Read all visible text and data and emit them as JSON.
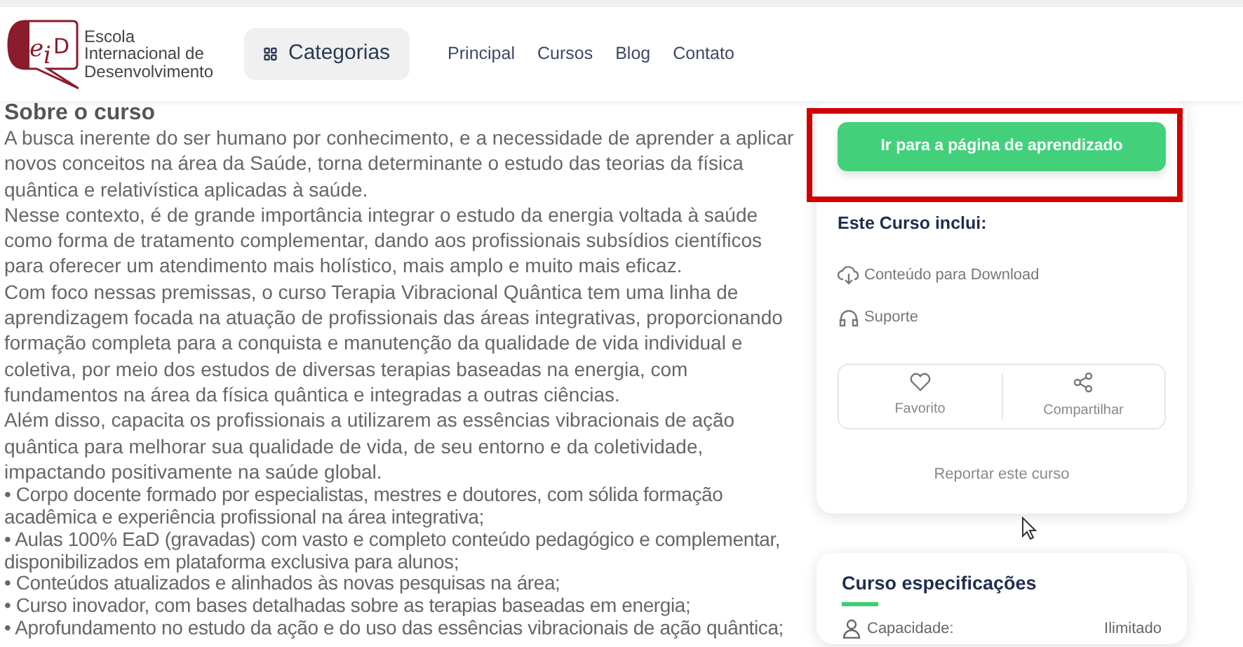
{
  "header": {
    "logo": {
      "mark": "eiD",
      "name_lines": [
        "Escola",
        "Internacional de",
        "Desenvolvimento"
      ]
    },
    "categories_button": "Categorias",
    "nav": [
      {
        "label": "Principal"
      },
      {
        "label": "Cursos"
      },
      {
        "label": "Blog"
      },
      {
        "label": "Contato"
      }
    ]
  },
  "about": {
    "title": "Sobre o curso",
    "paragraphs": [
      {
        "kind": "text",
        "text": "A busca inerente do ser humano por conhecimento, e a necessidade de aprender a aplicar novos conceitos na área da Saúde, torna determinante o estudo das teorias da física quântica e relativística aplicadas à saúde."
      },
      {
        "kind": "text",
        "text": "Nesse contexto, é de grande importância integrar o estudo da energia voltada à saúde como forma de tratamento complementar, dando aos profissionais subsídios científicos para oferecer um atendimento mais holístico, mais amplo e muito mais eficaz."
      },
      {
        "kind": "text",
        "text": "Com foco nessas premissas, o curso Terapia Vibracional Quântica tem uma linha de aprendizagem focada na atuação de profissionais das áreas integrativas, proporcionando formação completa para a conquista e manutenção da qualidade de vida individual e coletiva, por meio dos estudos de diversas terapias baseadas na energia, com fundamentos na área da física quântica e integradas a outras ciências."
      },
      {
        "kind": "text",
        "text": "Além disso, capacita os profissionais a utilizarem as essências vibracionais de ação quântica para melhorar sua qualidade de vida, de seu entorno e da coletividade, impactando positivamente na saúde global."
      },
      {
        "kind": "bullet",
        "text": "• Corpo docente formado por especialistas, mestres e doutores, com sólida formação acadêmica e experiência profissional na área integrativa;"
      },
      {
        "kind": "bullet",
        "text": "• Aulas 100% EaD (gravadas) com vasto e completo conteúdo pedagógico e complementar, disponibilizados em plataforma exclusiva para alunos;"
      },
      {
        "kind": "bullet",
        "text": "• Conteúdos atualizados e alinhados às novas pesquisas na área;"
      },
      {
        "kind": "bullet",
        "text": "• Curso inovador, com bases detalhadas sobre as terapias baseadas em energia;"
      },
      {
        "kind": "bullet",
        "text": "• Aprofundamento no estudo da ação e do uso das essências vibracionais de ação quântica;"
      }
    ]
  },
  "course_card": {
    "primary_button": "Ir para a página de aprendizado",
    "highlighted": true,
    "includes_title": "Este Curso inclui:",
    "includes": [
      {
        "kind": "download",
        "label": "Conteúdo para Download"
      },
      {
        "kind": "support",
        "label": "Suporte"
      }
    ],
    "actions": [
      {
        "kind": "favorite",
        "label": "Favorito"
      },
      {
        "kind": "share",
        "label": "Compartilhar"
      }
    ],
    "report_link": "Reportar este curso"
  },
  "specs_card": {
    "title": "Curso especificações",
    "rows": [
      {
        "kind": "capacity",
        "label": "Capacidade:",
        "value": "Ilimitado"
      }
    ]
  }
}
